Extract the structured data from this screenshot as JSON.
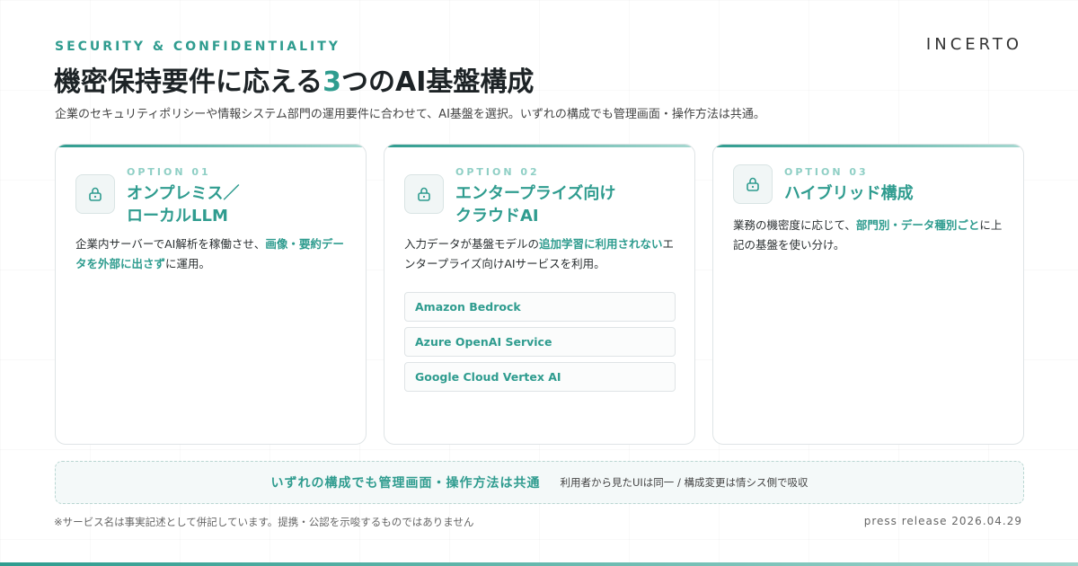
{
  "header": {
    "eyebrow": "SECURITY & CONFIDENTIALITY",
    "logo": "INCERTO",
    "title_pre": "機密保持要件に応える",
    "title_accent": "3",
    "title_post": "つのAI基盤構成",
    "subtitle": "企業のセキュリティポリシーや情報システム部門の運用要件に合わせて、AI基盤を選択。いずれの構成でも管理画面・操作方法は共通。"
  },
  "options": [
    {
      "label": "OPTION 01",
      "title_line1": "オンプレミス／",
      "title_line2": "ローカルLLM",
      "desc_a": "企業内サーバーでAI解析を稼働させ、",
      "desc_hl": "画像・要約データを外部に出さず",
      "desc_b": "に運用。"
    },
    {
      "label": "OPTION 02",
      "title_line1": "エンタープライズ向け",
      "title_line2": "クラウドAI",
      "desc_a": "入力データが基盤モデルの",
      "desc_hl": "追加学習に利用されない",
      "desc_b": "エンタープライズ向けAIサービスを利用。",
      "services": [
        "Amazon Bedrock",
        "Azure OpenAI Service",
        "Google Cloud Vertex AI"
      ]
    },
    {
      "label": "OPTION 03",
      "title_line1": "ハイブリッド構成",
      "desc_a": "業務の機密度に応じて、",
      "desc_hl": "部門別・データ種別ごと",
      "desc_b": "に上記の基盤を使い分け。"
    }
  ],
  "banner": {
    "main": "いずれの構成でも管理画面・操作方法は共通",
    "sub": "利用者から見たUIは同一 / 構成変更は情シス側で吸収"
  },
  "footer": {
    "note": "※サービス名は事実記述として併記しています。提携・公認を示唆するものではありません",
    "press": "press release 2026.04.29"
  },
  "colors": {
    "accent": "#2f9c8f",
    "accent_light": "#8fcfc5"
  },
  "icons": {
    "option": "lock-icon"
  }
}
